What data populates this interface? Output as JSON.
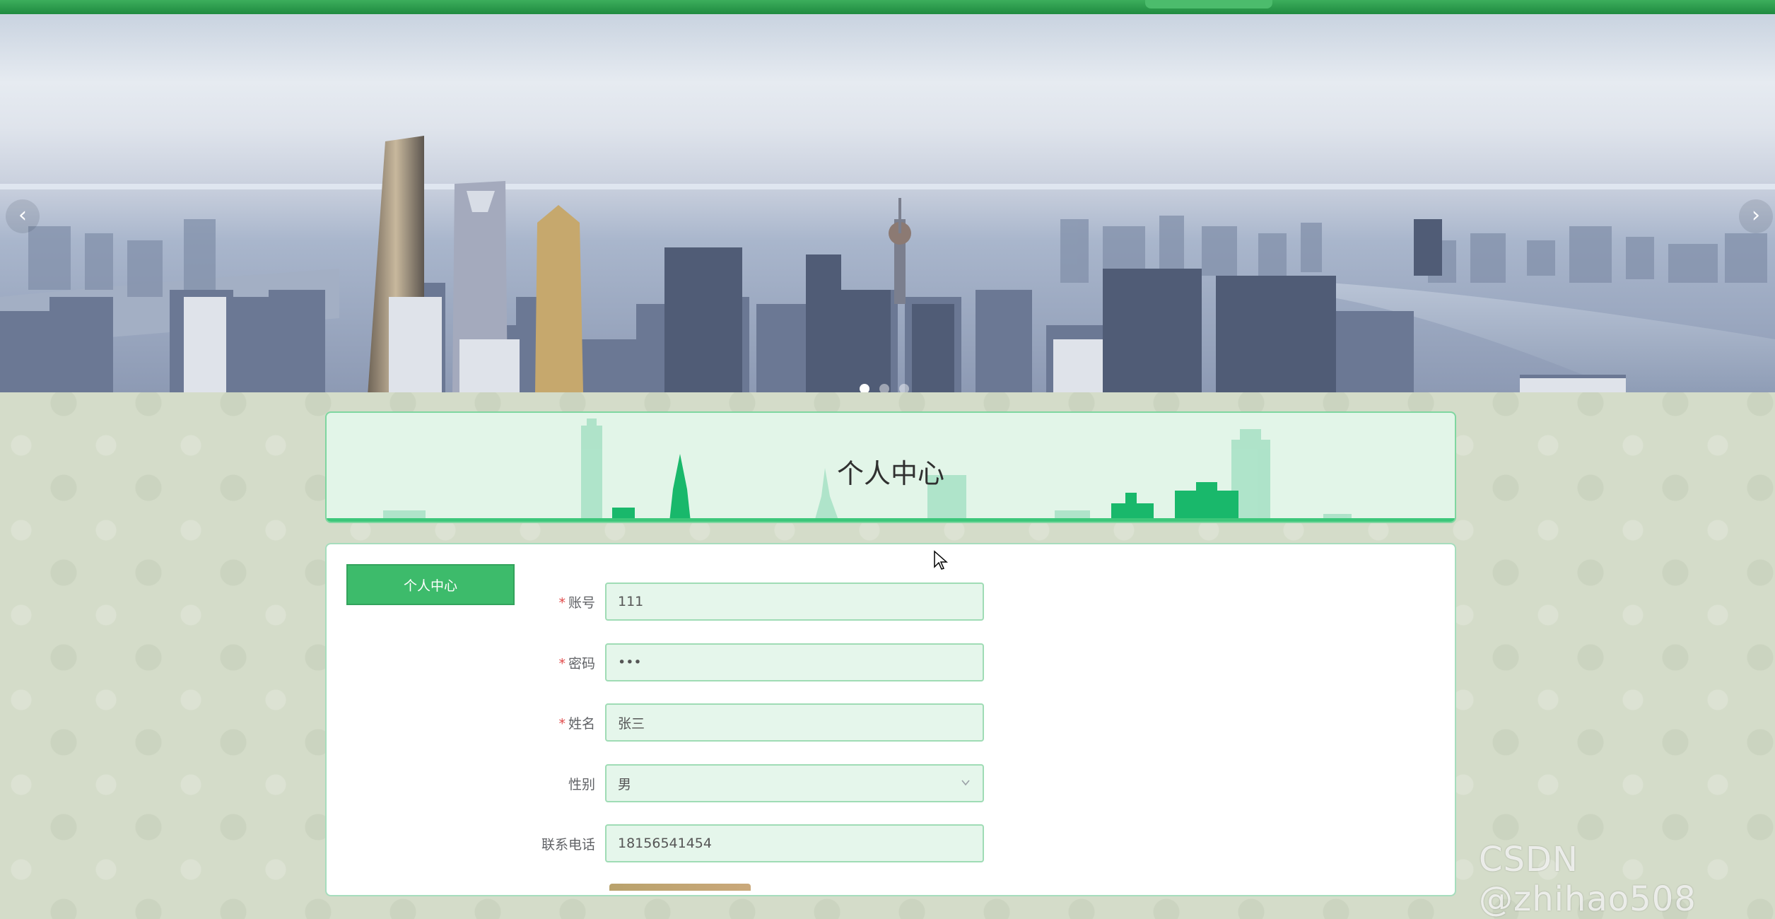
{
  "carousel": {
    "prev_glyph": "‹",
    "next_glyph": "›",
    "dots": [
      {
        "active": true
      },
      {
        "active": false
      },
      {
        "active": false
      }
    ]
  },
  "title_panel": {
    "title": "个人中心"
  },
  "sidebar": {
    "button_label": "个人中心"
  },
  "form": {
    "fields": [
      {
        "label": "账号",
        "required": true,
        "value": "111"
      },
      {
        "label": "密码",
        "required": true,
        "value": "•••"
      },
      {
        "label": "姓名",
        "required": true,
        "value": "张三"
      },
      {
        "label": "性别",
        "required": false,
        "value": "男"
      },
      {
        "label": "联系电话",
        "required": false,
        "value": "18156541454"
      }
    ]
  },
  "watermark": "CSDN @zhihao508",
  "colors": {
    "accent": "#3dbb6b",
    "topbar": "#1f8a40",
    "field_bg": "#e5f6eb",
    "page_bg": "#d4dcc9"
  }
}
